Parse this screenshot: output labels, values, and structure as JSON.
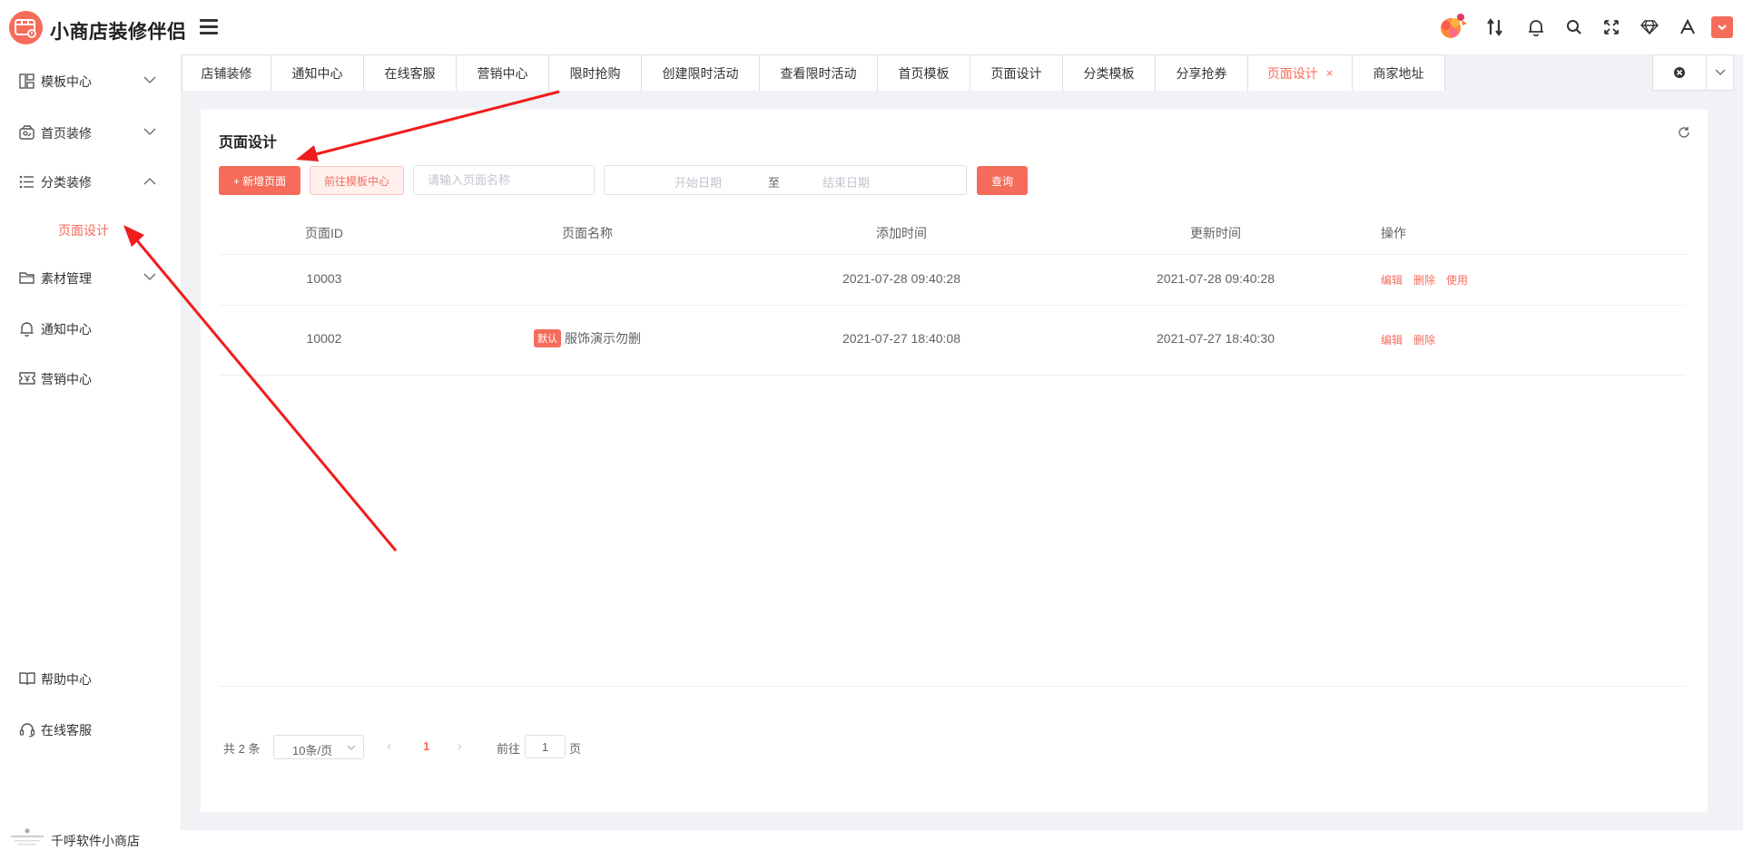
{
  "app": {
    "title": "小商店装修伴侣",
    "brand_color": "#f56c5b"
  },
  "header_icons": [
    "avatar-icon",
    "sort-icon",
    "bell-icon",
    "search-icon",
    "fullscreen-icon",
    "diamond-icon",
    "font-icon",
    "dropdown-icon"
  ],
  "sidebar": {
    "items": [
      {
        "label": "模板中心",
        "icon": "template-icon",
        "expanded": false
      },
      {
        "label": "首页装修",
        "icon": "home-decoration-icon",
        "expanded": false
      },
      {
        "label": "分类装修",
        "icon": "list-icon",
        "expanded": true
      },
      {
        "label": "页面设计",
        "icon": "",
        "active": true
      },
      {
        "label": "素材管理",
        "icon": "folder-icon",
        "expanded": false
      },
      {
        "label": "通知中心",
        "icon": "bell-icon"
      },
      {
        "label": "营销中心",
        "icon": "coupon-icon"
      }
    ],
    "footer": [
      {
        "label": "帮助中心",
        "icon": "book-icon"
      },
      {
        "label": "在线客服",
        "icon": "headset-icon"
      }
    ],
    "shop_name": "千呼软件小商店"
  },
  "tabs": [
    {
      "label": "店铺装修"
    },
    {
      "label": "通知中心"
    },
    {
      "label": "在线客服"
    },
    {
      "label": "营销中心"
    },
    {
      "label": "限时抢购"
    },
    {
      "label": "创建限时活动"
    },
    {
      "label": "查看限时活动"
    },
    {
      "label": "首页模板"
    },
    {
      "label": "页面设计"
    },
    {
      "label": "分类模板"
    },
    {
      "label": "分享抢券"
    },
    {
      "label": "页面设计",
      "active": true,
      "close": "×"
    },
    {
      "label": "商家地址"
    }
  ],
  "panel": {
    "title": "页面设计",
    "add_button": "+ 新增页面",
    "template_button": "前往模板中心",
    "name_placeholder": "请输入页面名称",
    "start_placeholder": "开始日期",
    "range_sep": "至",
    "end_placeholder": "结束日期",
    "query_button": "查询"
  },
  "table": {
    "columns": [
      "页面ID",
      "页面名称",
      "添加时间",
      "更新时间",
      "操作"
    ],
    "rows": [
      {
        "id": "10003",
        "badge": "",
        "name": "",
        "created": "2021-07-28 09:40:28",
        "updated": "2021-07-28 09:40:28",
        "actions": [
          "编辑",
          "删除",
          "使用"
        ]
      },
      {
        "id": "10002",
        "badge": "默认",
        "name": "服饰演示勿删",
        "created": "2021-07-27 18:40:08",
        "updated": "2021-07-27 18:40:30",
        "actions": [
          "编辑",
          "删除"
        ]
      }
    ]
  },
  "pagination": {
    "total": "共 2 条",
    "page_size": "10条/页",
    "current_page": "1",
    "goto_label": "前往",
    "goto_value": "1",
    "page_suffix": "页"
  }
}
